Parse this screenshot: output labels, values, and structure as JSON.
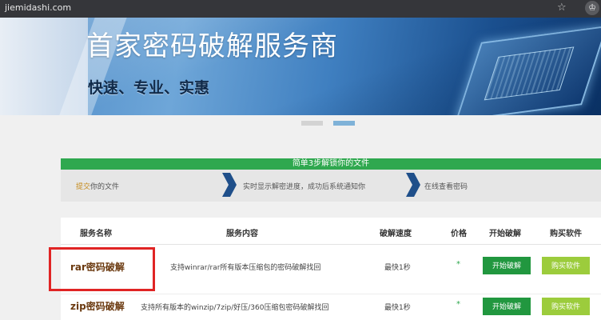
{
  "browser": {
    "url": "jiemidashi.com",
    "star_icon": "☆",
    "extension_icon": "♔"
  },
  "banner": {
    "title": "首家密码破解服务商",
    "subtitle": "快速、专业、实惠"
  },
  "steps": {
    "header": "简单3步解锁你的文件",
    "step1_highlight": "提交",
    "step1_rest": "你的文件",
    "step2": "实时显示解密进度，成功后系统通知你",
    "step3": "在线查看密码"
  },
  "table": {
    "headers": [
      "服务名称",
      "服务内容",
      "破解速度",
      "价格",
      "开始破解",
      "购买软件"
    ],
    "rows": [
      {
        "name": "rar密码破解",
        "content": "支持winrar/rar所有版本压缩包的密码破解找回",
        "speed": "最快1秒",
        "price": "*",
        "start": "开始破解",
        "buy": "购买软件"
      },
      {
        "name": "zip密码破解",
        "content": "支持所有版本的winzip/7zip/好压/360压缩包密码破解找回",
        "speed": "最快1秒",
        "price": "*",
        "start": "开始破解",
        "buy": "购买软件"
      }
    ]
  },
  "colors": {
    "green": "#2fa84f",
    "buy_green": "#9ccc3c",
    "highlight_red": "#e02424",
    "arrow_blue": "#1f4f8a"
  }
}
